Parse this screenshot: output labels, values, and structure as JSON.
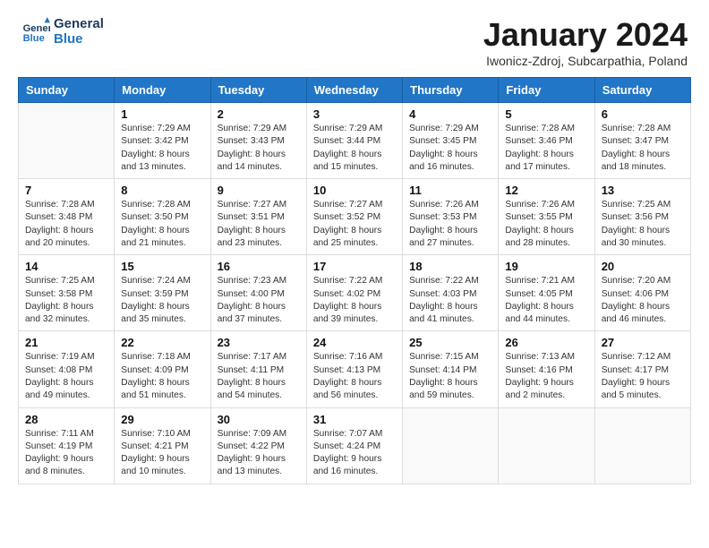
{
  "logo": {
    "line1": "General",
    "line2": "Blue"
  },
  "title": "January 2024",
  "subtitle": "Iwonicz-Zdroj, Subcarpathia, Poland",
  "days_header": [
    "Sunday",
    "Monday",
    "Tuesday",
    "Wednesday",
    "Thursday",
    "Friday",
    "Saturday"
  ],
  "weeks": [
    [
      {
        "num": "",
        "info": ""
      },
      {
        "num": "1",
        "info": "Sunrise: 7:29 AM\nSunset: 3:42 PM\nDaylight: 8 hours\nand 13 minutes."
      },
      {
        "num": "2",
        "info": "Sunrise: 7:29 AM\nSunset: 3:43 PM\nDaylight: 8 hours\nand 14 minutes."
      },
      {
        "num": "3",
        "info": "Sunrise: 7:29 AM\nSunset: 3:44 PM\nDaylight: 8 hours\nand 15 minutes."
      },
      {
        "num": "4",
        "info": "Sunrise: 7:29 AM\nSunset: 3:45 PM\nDaylight: 8 hours\nand 16 minutes."
      },
      {
        "num": "5",
        "info": "Sunrise: 7:28 AM\nSunset: 3:46 PM\nDaylight: 8 hours\nand 17 minutes."
      },
      {
        "num": "6",
        "info": "Sunrise: 7:28 AM\nSunset: 3:47 PM\nDaylight: 8 hours\nand 18 minutes."
      }
    ],
    [
      {
        "num": "7",
        "info": "Sunrise: 7:28 AM\nSunset: 3:48 PM\nDaylight: 8 hours\nand 20 minutes."
      },
      {
        "num": "8",
        "info": "Sunrise: 7:28 AM\nSunset: 3:50 PM\nDaylight: 8 hours\nand 21 minutes."
      },
      {
        "num": "9",
        "info": "Sunrise: 7:27 AM\nSunset: 3:51 PM\nDaylight: 8 hours\nand 23 minutes."
      },
      {
        "num": "10",
        "info": "Sunrise: 7:27 AM\nSunset: 3:52 PM\nDaylight: 8 hours\nand 25 minutes."
      },
      {
        "num": "11",
        "info": "Sunrise: 7:26 AM\nSunset: 3:53 PM\nDaylight: 8 hours\nand 27 minutes."
      },
      {
        "num": "12",
        "info": "Sunrise: 7:26 AM\nSunset: 3:55 PM\nDaylight: 8 hours\nand 28 minutes."
      },
      {
        "num": "13",
        "info": "Sunrise: 7:25 AM\nSunset: 3:56 PM\nDaylight: 8 hours\nand 30 minutes."
      }
    ],
    [
      {
        "num": "14",
        "info": "Sunrise: 7:25 AM\nSunset: 3:58 PM\nDaylight: 8 hours\nand 32 minutes."
      },
      {
        "num": "15",
        "info": "Sunrise: 7:24 AM\nSunset: 3:59 PM\nDaylight: 8 hours\nand 35 minutes."
      },
      {
        "num": "16",
        "info": "Sunrise: 7:23 AM\nSunset: 4:00 PM\nDaylight: 8 hours\nand 37 minutes."
      },
      {
        "num": "17",
        "info": "Sunrise: 7:22 AM\nSunset: 4:02 PM\nDaylight: 8 hours\nand 39 minutes."
      },
      {
        "num": "18",
        "info": "Sunrise: 7:22 AM\nSunset: 4:03 PM\nDaylight: 8 hours\nand 41 minutes."
      },
      {
        "num": "19",
        "info": "Sunrise: 7:21 AM\nSunset: 4:05 PM\nDaylight: 8 hours\nand 44 minutes."
      },
      {
        "num": "20",
        "info": "Sunrise: 7:20 AM\nSunset: 4:06 PM\nDaylight: 8 hours\nand 46 minutes."
      }
    ],
    [
      {
        "num": "21",
        "info": "Sunrise: 7:19 AM\nSunset: 4:08 PM\nDaylight: 8 hours\nand 49 minutes."
      },
      {
        "num": "22",
        "info": "Sunrise: 7:18 AM\nSunset: 4:09 PM\nDaylight: 8 hours\nand 51 minutes."
      },
      {
        "num": "23",
        "info": "Sunrise: 7:17 AM\nSunset: 4:11 PM\nDaylight: 8 hours\nand 54 minutes."
      },
      {
        "num": "24",
        "info": "Sunrise: 7:16 AM\nSunset: 4:13 PM\nDaylight: 8 hours\nand 56 minutes."
      },
      {
        "num": "25",
        "info": "Sunrise: 7:15 AM\nSunset: 4:14 PM\nDaylight: 8 hours\nand 59 minutes."
      },
      {
        "num": "26",
        "info": "Sunrise: 7:13 AM\nSunset: 4:16 PM\nDaylight: 9 hours\nand 2 minutes."
      },
      {
        "num": "27",
        "info": "Sunrise: 7:12 AM\nSunset: 4:17 PM\nDaylight: 9 hours\nand 5 minutes."
      }
    ],
    [
      {
        "num": "28",
        "info": "Sunrise: 7:11 AM\nSunset: 4:19 PM\nDaylight: 9 hours\nand 8 minutes."
      },
      {
        "num": "29",
        "info": "Sunrise: 7:10 AM\nSunset: 4:21 PM\nDaylight: 9 hours\nand 10 minutes."
      },
      {
        "num": "30",
        "info": "Sunrise: 7:09 AM\nSunset: 4:22 PM\nDaylight: 9 hours\nand 13 minutes."
      },
      {
        "num": "31",
        "info": "Sunrise: 7:07 AM\nSunset: 4:24 PM\nDaylight: 9 hours\nand 16 minutes."
      },
      {
        "num": "",
        "info": ""
      },
      {
        "num": "",
        "info": ""
      },
      {
        "num": "",
        "info": ""
      }
    ]
  ]
}
